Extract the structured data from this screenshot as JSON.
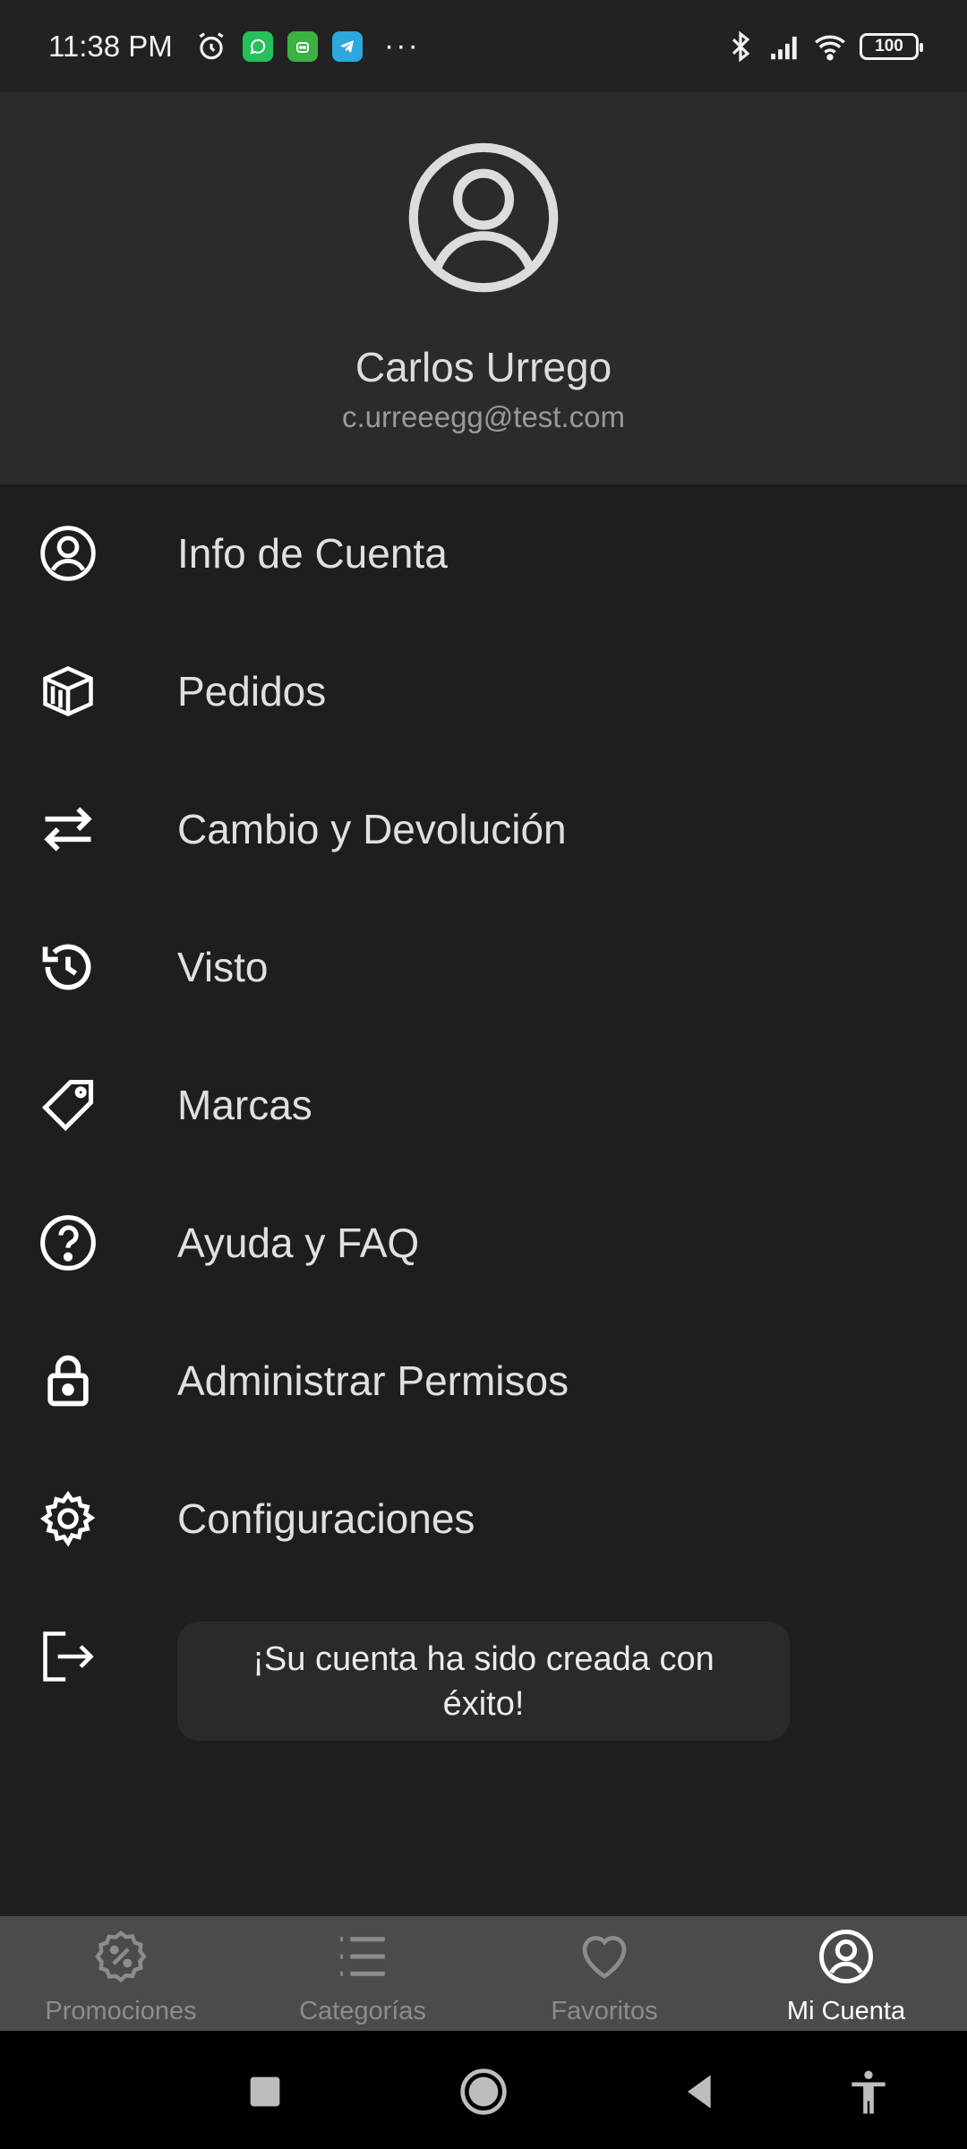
{
  "status_bar": {
    "time": "11:38 PM",
    "icons": [
      "alarm-icon",
      "whatsapp-icon",
      "android-app-icon",
      "telegram-icon",
      "more-dots-icon",
      "bluetooth-icon",
      "signal-icon",
      "wifi-icon",
      "battery-icon"
    ],
    "more": "···",
    "battery": "100"
  },
  "profile": {
    "name": "Carlos Urrego",
    "email": "c.urreeegg@test.com"
  },
  "menu": {
    "items": [
      {
        "label": "Info de Cuenta",
        "icon": "account-circle-icon"
      },
      {
        "label": "Pedidos",
        "icon": "orders-box-icon"
      },
      {
        "label": "Cambio y Devolución",
        "icon": "swap-arrows-icon"
      },
      {
        "label": "Visto",
        "icon": "history-icon"
      },
      {
        "label": "Marcas",
        "icon": "tag-icon"
      },
      {
        "label": "Ayuda y FAQ",
        "icon": "help-circle-icon"
      },
      {
        "label": "Administrar Permisos",
        "icon": "lock-icon"
      },
      {
        "label": "Configuraciones",
        "icon": "gear-icon"
      },
      {
        "label": "",
        "icon": "logout-icon"
      }
    ]
  },
  "toast": {
    "message": "¡Su cuenta ha sido creada con éxito!"
  },
  "bottom_nav": {
    "items": [
      {
        "label": "Promociones",
        "icon": "percent-badge-icon",
        "active": false
      },
      {
        "label": "Categorías",
        "icon": "list-icon",
        "active": false
      },
      {
        "label": "Favoritos",
        "icon": "heart-icon",
        "active": false
      },
      {
        "label": "Mi Cuenta",
        "icon": "account-circle-icon",
        "active": true
      }
    ]
  },
  "colors": {
    "background": "#1e1e1f",
    "header": "#2b2b2c",
    "bottom_nav": "#4b4b4c",
    "active": "#ffffff",
    "inactive": "#8c8c8c"
  }
}
